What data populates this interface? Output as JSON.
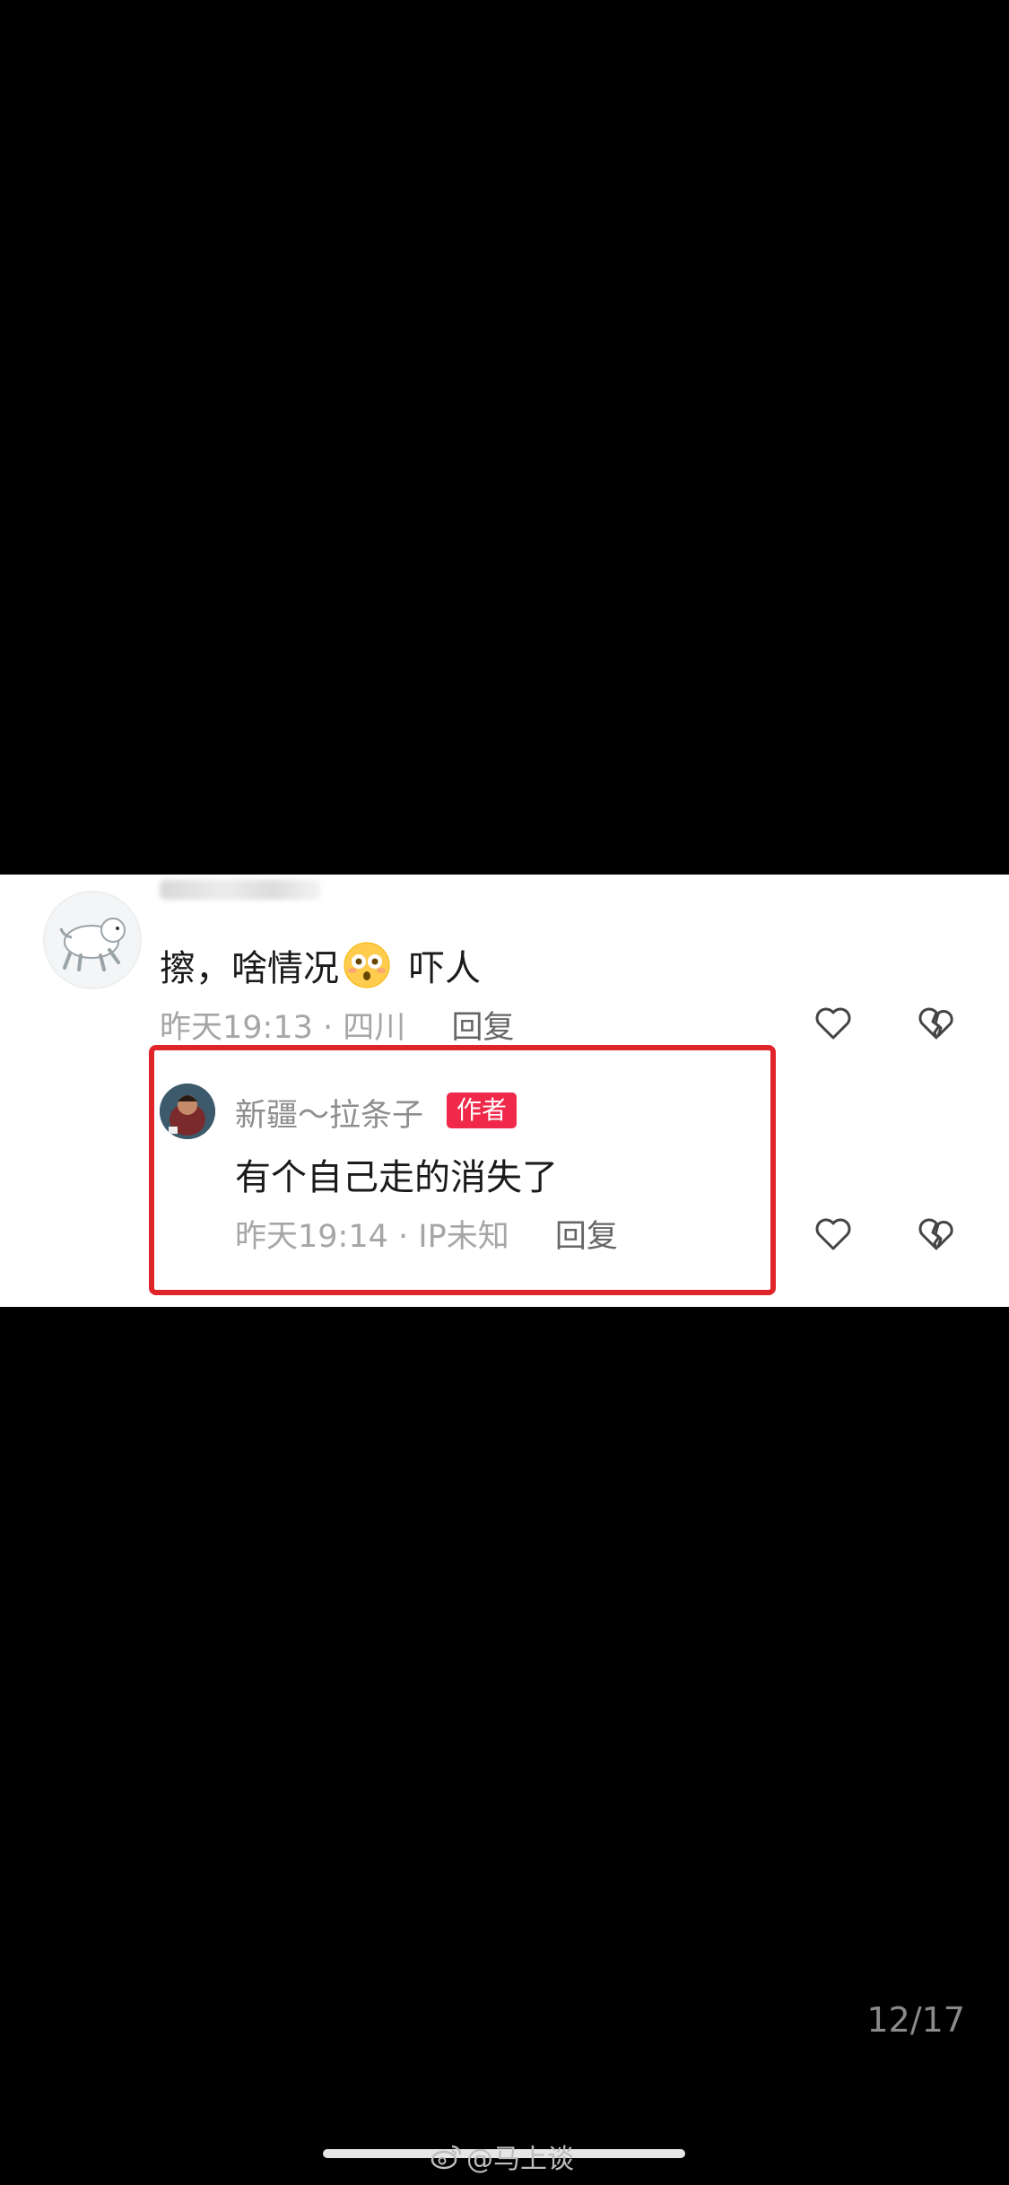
{
  "comment": {
    "text": "擦，啥情况",
    "suffix": "吓人",
    "emoji": "flushed-face-emoji",
    "time": "昨天19:13",
    "location": "四川",
    "reply_label": "回复"
  },
  "author_reply": {
    "username": "新疆～拉条子",
    "badge": "作者",
    "text": "有个自己走的消失了",
    "time": "昨天19:14",
    "location": "IP未知",
    "reply_label": "回复"
  },
  "icons": {
    "like": "heart-icon",
    "dislike": "broken-heart-icon",
    "weibo": "weibo-logo-icon"
  },
  "colors": {
    "highlight_border": "#e0252a",
    "author_badge_bg": "#f0294a",
    "background": "#000000"
  },
  "viewer": {
    "page_counter": "12/17"
  },
  "watermark": {
    "handle": "@马上谈"
  }
}
